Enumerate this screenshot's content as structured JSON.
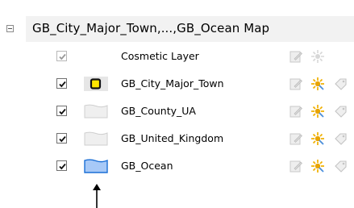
{
  "tree": {
    "root_label": "GB_City_Major_Town,...,GB_Ocean Map",
    "layers": [
      {
        "label": "Cosmetic Layer",
        "checked": true,
        "enabled": false,
        "swatch": "none",
        "tools": [
          "edit",
          "snap"
        ]
      },
      {
        "label": "GB_City_Major_Town",
        "checked": true,
        "enabled": true,
        "swatch": "point-symbol",
        "tools": [
          "edit",
          "snap",
          "label"
        ]
      },
      {
        "label": "GB_County_UA",
        "checked": true,
        "enabled": true,
        "swatch": "region-empty",
        "tools": [
          "edit",
          "snap",
          "label"
        ]
      },
      {
        "label": "GB_United_Kingdom",
        "checked": true,
        "enabled": true,
        "swatch": "region-empty",
        "tools": [
          "edit",
          "snap",
          "label"
        ]
      },
      {
        "label": "GB_Ocean",
        "checked": true,
        "enabled": true,
        "swatch": "region-blue",
        "tools": [
          "edit",
          "snap",
          "label"
        ]
      }
    ]
  },
  "colors": {
    "ocean_fill": "#a7c9f7",
    "ocean_stroke": "#1a6fd6",
    "point_fill": "#ffe600",
    "point_bg": "#e6e6e6",
    "region_fill": "#efefef",
    "region_stroke": "#cfcfcf"
  },
  "icons": [
    "collapse-icon",
    "checkbox-icon",
    "edit-icon",
    "snap-icon",
    "label-icon",
    "arrow-icon"
  ]
}
